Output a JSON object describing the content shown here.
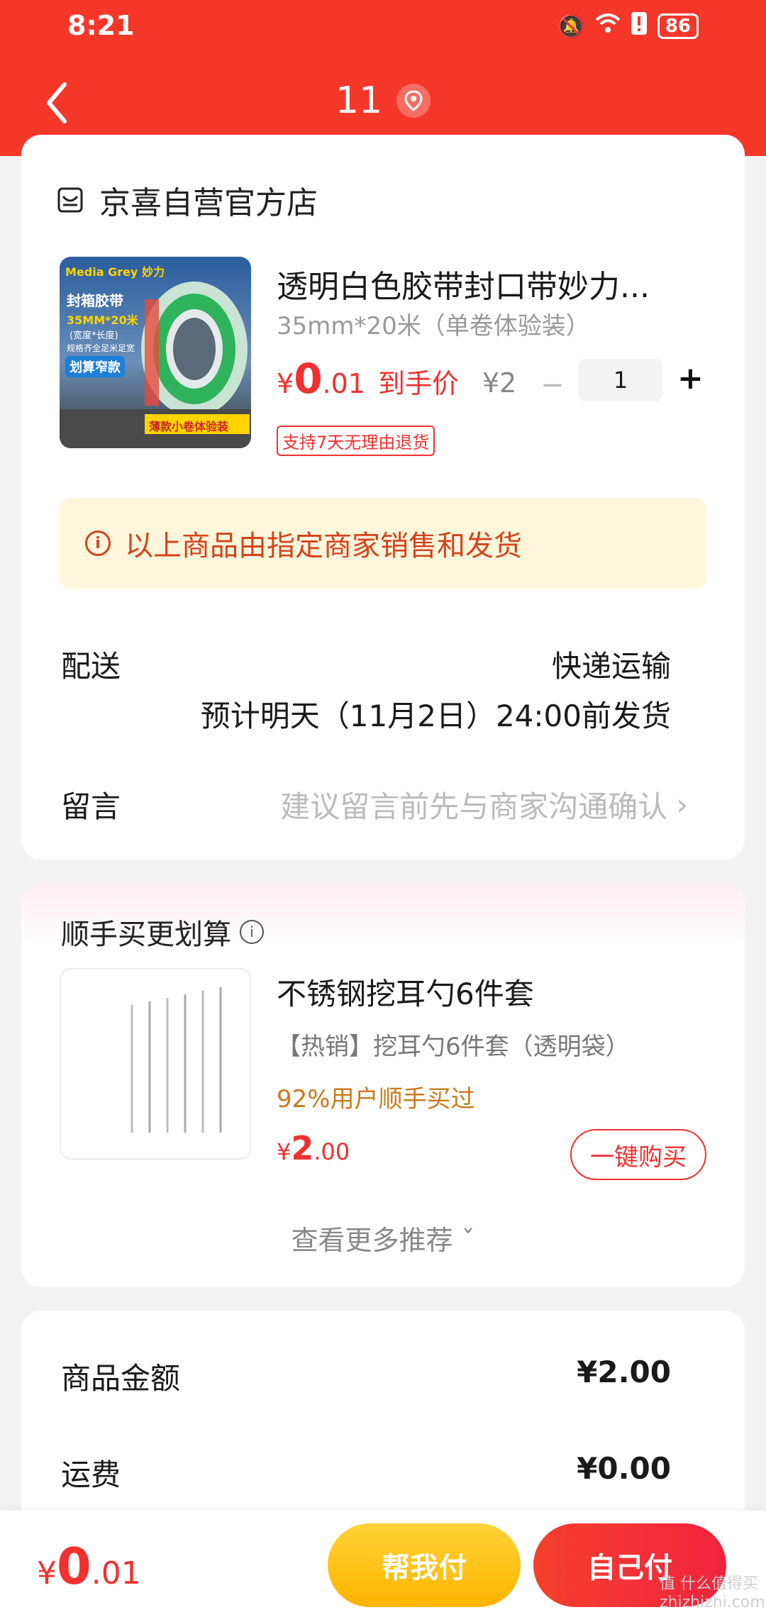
{
  "status": {
    "time": "8:21",
    "battery": "86"
  },
  "nav": {
    "title": "11"
  },
  "store": {
    "name": "京喜自营官方店"
  },
  "product": {
    "title": "透明白色胶带封口带妙力...",
    "spec": "35mm*20米（单卷体验装）",
    "price_symbol": "¥",
    "price_int": "0",
    "price_dec": ".01",
    "price_tag": "到手价",
    "orig_price": "¥2",
    "minus": "−",
    "qty": "1",
    "plus": "+",
    "return_badge": "支持7天无理由退货",
    "image_text": {
      "brand": "Media Grey 妙力",
      "line1": "封箱胶带",
      "line2": "35MM*20米",
      "line3": "(宽度*长度)",
      "line4": "规格齐全足米足宽",
      "badge": "划算窄款",
      "footer": "薄款小卷体验装"
    }
  },
  "notice": {
    "text": "以上商品由指定商家销售和发货"
  },
  "shipping": {
    "label": "配送",
    "method": "快递运输",
    "eta": "预计明天（11月2日）24:00前发货"
  },
  "message": {
    "label": "留言",
    "hint": "建议留言前先与商家沟通确认",
    "chevron": "›"
  },
  "recommend": {
    "title": "顺手买更划算",
    "item_name": "不锈钢挖耳勺6件套",
    "item_desc": "【热销】挖耳勺6件套（透明袋）",
    "item_pct": "92%用户顺手买过",
    "price_symbol": "¥",
    "price_int": "2",
    "price_dec": ".00",
    "buy_label": "一键购买",
    "more": "查看更多推荐 ˇ"
  },
  "summary": {
    "goods_label": "商品金额",
    "goods_value": "¥2.00",
    "freight_label": "运费",
    "freight_value": "¥0.00"
  },
  "bottom": {
    "total_symbol": "¥",
    "total_int": "0",
    "total_dec": ".01",
    "help_pay": "帮我付",
    "self_pay": "自己付",
    "watermark": "值 什么值得买 zhizhizhi.com"
  },
  "colors": {
    "header": "#f5372a",
    "accent": "#f23030",
    "notice_bg": "#fff7dc",
    "help_pay": "#ffc21a"
  }
}
